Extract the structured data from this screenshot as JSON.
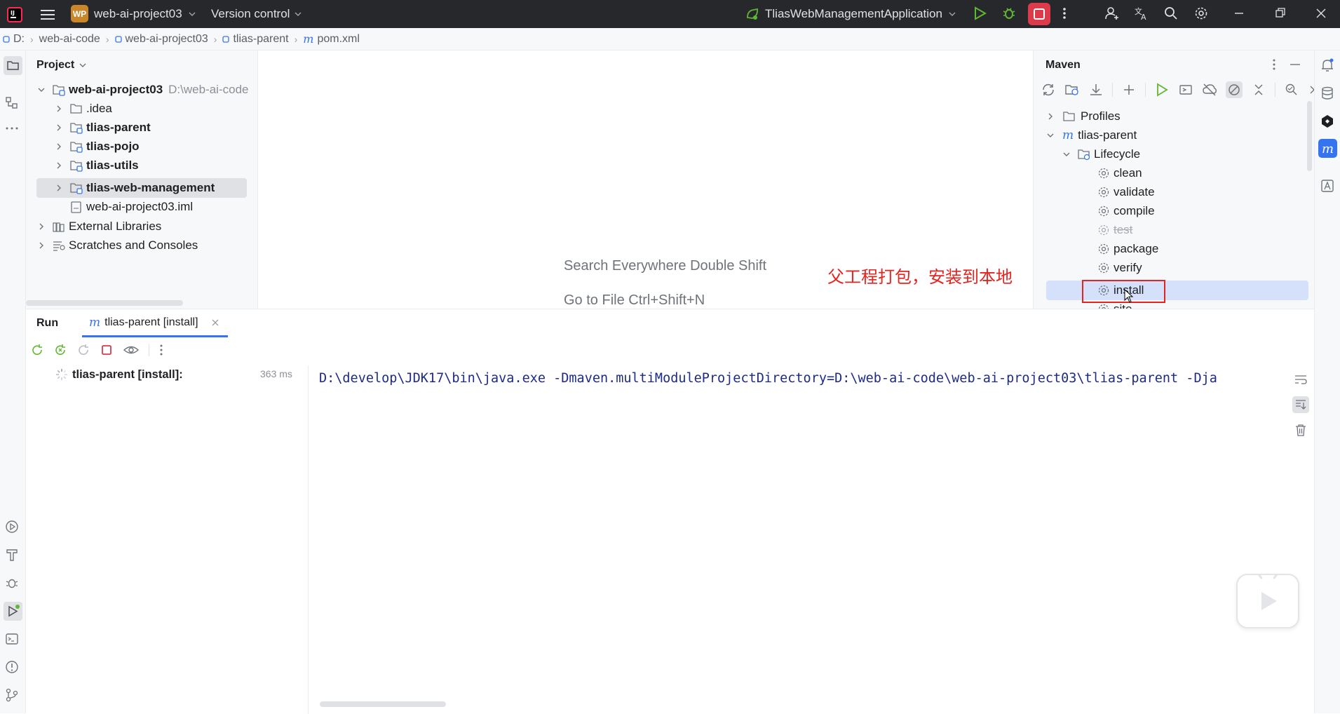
{
  "titlebar": {
    "project_badge": "WP",
    "project_name": "web-ai-project03",
    "version_control": "Version control",
    "run_config": "TliasWebManagementApplication"
  },
  "breadcrumb": [
    "D:",
    "web-ai-code",
    "web-ai-project03",
    "tlias-parent",
    "pom.xml"
  ],
  "project": {
    "title": "Project",
    "root_name": "web-ai-project03",
    "root_path": "D:\\web-ai-code",
    "items": [
      ".idea",
      "tlias-parent",
      "tlias-pojo",
      "tlias-utils",
      "tlias-web-management",
      "web-ai-project03.iml"
    ],
    "external": "External Libraries",
    "scratches": "Scratches and Consoles"
  },
  "editor": {
    "hint1": "Search Everywhere Double Shift",
    "hint2": "Go to File Ctrl+Shift+N",
    "annotation": "父工程打包，安装到本地"
  },
  "maven": {
    "title": "Maven",
    "profiles": "Profiles",
    "project": "tlias-parent",
    "lifecycle": "Lifecycle",
    "phases": [
      "clean",
      "validate",
      "compile",
      "test",
      "package",
      "verify",
      "install",
      "site"
    ]
  },
  "run": {
    "label": "Run",
    "tab": "tlias-parent [install]",
    "tree_item": "tlias-parent [install]:",
    "duration": "363 ms",
    "console": "D:\\develop\\JDK17\\bin\\java.exe -Dmaven.multiModuleProjectDirectory=D:\\web-ai-code\\web-ai-project03\\tlias-parent -Dja"
  },
  "colors": {
    "titlebar": "#27282c",
    "accent": "#3574f0",
    "annotation": "#e8231e",
    "stop": "#db3b4b",
    "console_text": "#1d2a86"
  }
}
